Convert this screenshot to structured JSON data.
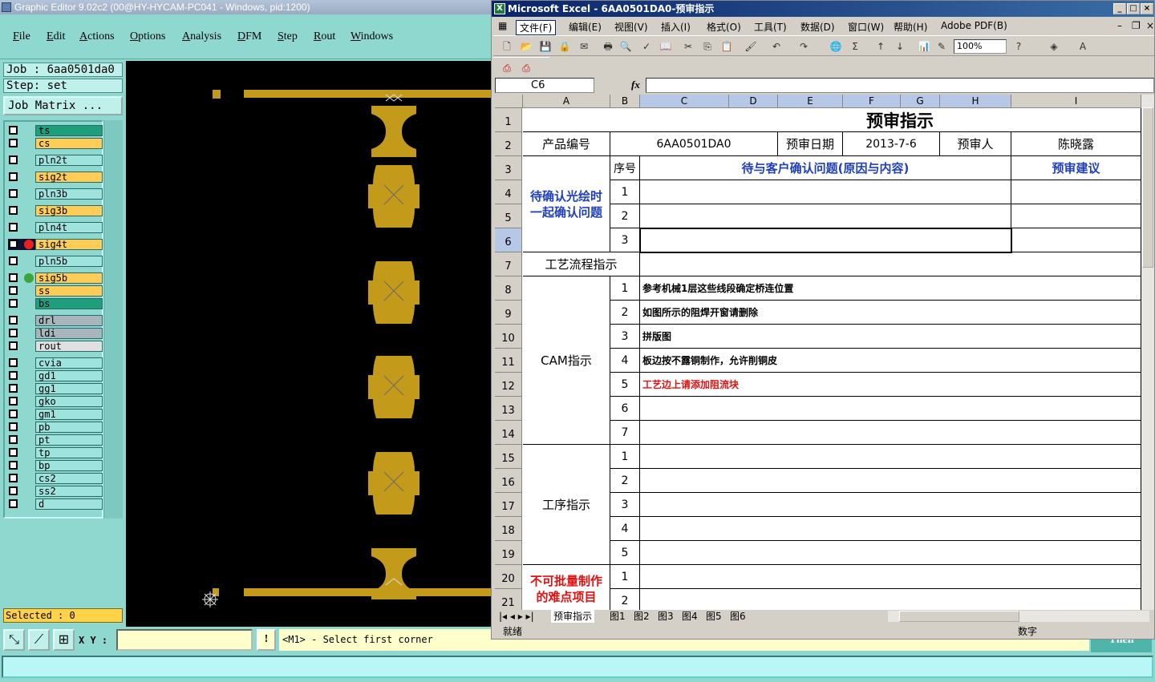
{
  "graphic_editor": {
    "title": "Graphic Editor 9.02c2 (00@HY-HYCAM-PC041 - Windows, pid:1200)",
    "menu": [
      "File",
      "Edit",
      "Actions",
      "Options",
      "Analysis",
      "DFM",
      "Step",
      "Rout",
      "Windows"
    ],
    "job_label": "Job : 6aa0501da0",
    "step_label": "Step: set",
    "job_matrix_button": "Job Matrix ...",
    "layers": [
      {
        "name": "ts",
        "color": "#1f9e7c"
      },
      {
        "name": "cs",
        "color": "#ffcc55"
      },
      {
        "name": "pln2t",
        "color": "#9fe3df"
      },
      {
        "name": "sig2t",
        "color": "#ffcc55"
      },
      {
        "name": "pln3b",
        "color": "#9fe3df"
      },
      {
        "name": "sig3b",
        "color": "#ffcc55"
      },
      {
        "name": "pln4t",
        "color": "#9fe3df"
      },
      {
        "name": "sig4t",
        "color": "#ffcc55"
      },
      {
        "name": "pln5b",
        "color": "#9fe3df"
      },
      {
        "name": "sig5b",
        "color": "#ffcc55"
      },
      {
        "name": "ss",
        "color": "#ffcc55"
      },
      {
        "name": "bs",
        "color": "#1f9e7c"
      },
      {
        "name": "drl",
        "color": "#a6b6bb"
      },
      {
        "name": "ldi",
        "color": "#a6b6bb"
      },
      {
        "name": "rout",
        "color": "#e0e0e0"
      },
      {
        "name": "cvia",
        "color": "#9fe3df"
      },
      {
        "name": "gd1",
        "color": "#9fe3df"
      },
      {
        "name": "gg1",
        "color": "#9fe3df"
      },
      {
        "name": "gko",
        "color": "#9fe3df"
      },
      {
        "name": "gm1",
        "color": "#9fe3df"
      },
      {
        "name": "pb",
        "color": "#9fe3df"
      },
      {
        "name": "pt",
        "color": "#9fe3df"
      },
      {
        "name": "tp",
        "color": "#9fe3df"
      },
      {
        "name": "bp",
        "color": "#9fe3df"
      },
      {
        "name": "cs2",
        "color": "#9fe3df"
      },
      {
        "name": "ss2",
        "color": "#9fe3df"
      },
      {
        "name": "d",
        "color": "#9fe3df"
      }
    ],
    "selected_text": "Selected : 0",
    "xy_label": "X Y :",
    "xy_value": "",
    "alert_label": "!",
    "status_message": "<M1> - Select first corner",
    "then_button": "Then",
    "pcb_color": "#c49a1a"
  },
  "excel": {
    "title": "Microsoft Excel - 6AA0501DA0-预审指示",
    "menu": [
      "文件(F)",
      "编辑(E)",
      "视图(V)",
      "插入(I)",
      "格式(O)",
      "工具(T)",
      "数据(D)",
      "窗口(W)",
      "帮助(H)",
      "Adobe PDF(B)"
    ],
    "zoom": "100%",
    "name_box": "C6",
    "fx_label": "fx",
    "columns": [
      "A",
      "B",
      "C",
      "D",
      "E",
      "F",
      "G",
      "H",
      "I"
    ],
    "rows": [
      "1",
      "2",
      "3",
      "4",
      "5",
      "6",
      "7",
      "8",
      "9",
      "10",
      "11",
      "12",
      "13",
      "14",
      "15",
      "16",
      "17",
      "18",
      "19",
      "20",
      "21"
    ],
    "sheet": {
      "title": "预审指示",
      "product_no_label": "产品编号",
      "product_no": "6AA0501DA0",
      "review_date_label": "预审日期",
      "review_date": "2013-7-6",
      "reviewer_label": "预审人",
      "reviewer": "陈晓露",
      "seq_label": "序号",
      "confirm_header": "待与客户确认问题(原因与内容)",
      "suggestion_header": "预审建议",
      "pending_label": "待确认光绘时一起确认问题",
      "process_flow_label": "工艺流程指示",
      "cam_label": "CAM指示",
      "procedure_label": "工序指示",
      "hard_items_label": "不可批量制作的难点项目",
      "confirm_numbers": [
        "1",
        "2",
        "3"
      ],
      "cam_numbers": [
        "1",
        "2",
        "3",
        "4",
        "5",
        "6",
        "7"
      ],
      "cam_items": [
        "参考机械1层这些线段确定桥连位置",
        "如图所示的阻焊开窗请删除",
        "拼版图",
        "板边按不露铜制作，允许削铜皮",
        "工艺边上请添加阻流块",
        "",
        ""
      ],
      "procedure_numbers": [
        "1",
        "2",
        "3",
        "4",
        "5"
      ],
      "hard_numbers": [
        "1",
        "2"
      ]
    },
    "sheet_tabs": [
      "预审指示",
      "图1",
      "图2",
      "图3",
      "图4",
      "图5",
      "图6"
    ],
    "status_ready": "就绪",
    "status_mode": "数字"
  }
}
